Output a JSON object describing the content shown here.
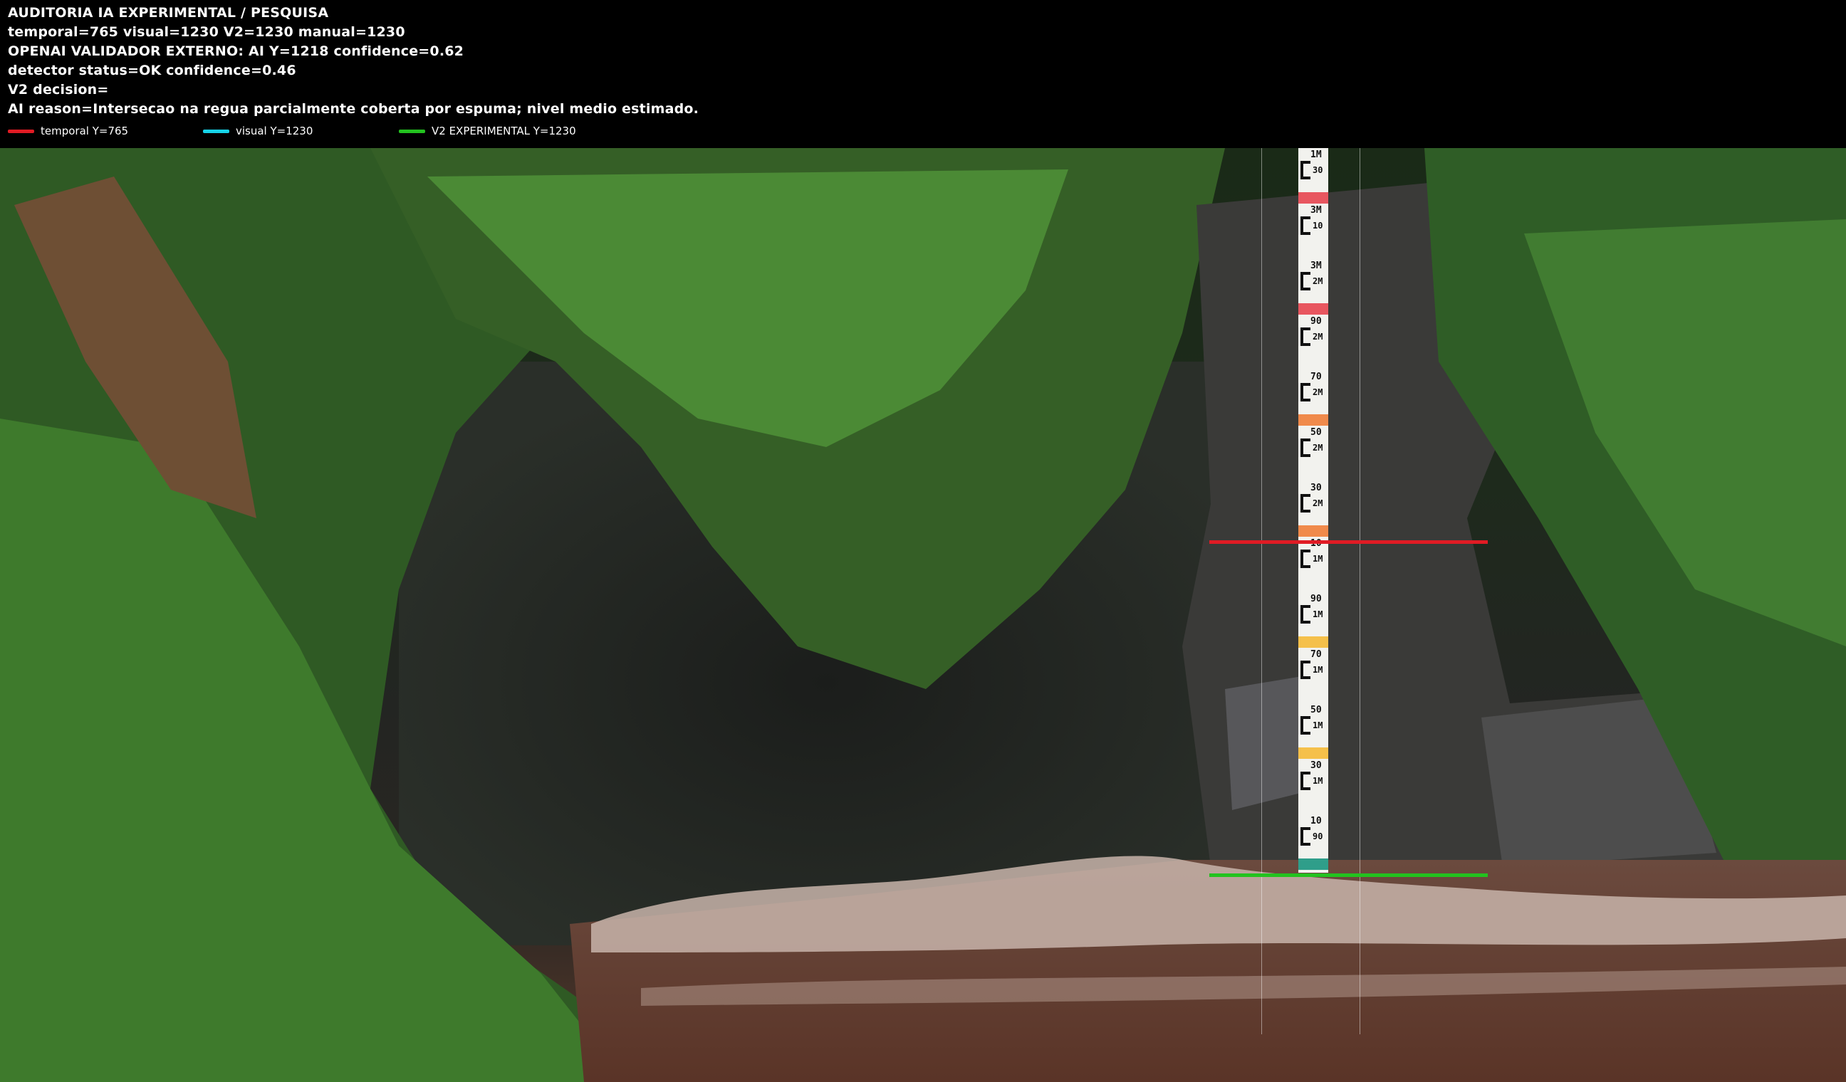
{
  "overlay": {
    "line1": "AUDITORIA IA  EXPERIMENTAL / PESQUISA",
    "line2": "temporal=765  visual=1230  V2=1230  manual=1230",
    "line3": "OPENAI  VALIDADOR EXTERNO: AI Y=1218  confidence=0.62",
    "line4": "detector status=OK confidence=0.46",
    "line5": "V2 decision=",
    "line6": "AI reason=Intersecao na regua parcialmente coberta por espuma; nivel medio estimado."
  },
  "legend": [
    {
      "label": "temporal Y=765",
      "color": "#e01b24"
    },
    {
      "label": "visual Y=1230",
      "color": "#16d3e8"
    },
    {
      "label": "V2 EXPERIMENTAL Y=1230",
      "color": "#23c21f"
    }
  ],
  "markers": {
    "temporal_line_color": "#e01b24",
    "v2_line_color": "#23c21f"
  },
  "staff": {
    "labels": [
      "1M",
      "30",
      "3M",
      "10",
      "3M",
      "2M",
      "90",
      "2M",
      "70",
      "2M",
      "50",
      "2M",
      "30",
      "2M",
      "10",
      "1M",
      "90",
      "1M",
      "70",
      "1M",
      "50",
      "1M",
      "30",
      "1M",
      "10",
      "90"
    ]
  }
}
